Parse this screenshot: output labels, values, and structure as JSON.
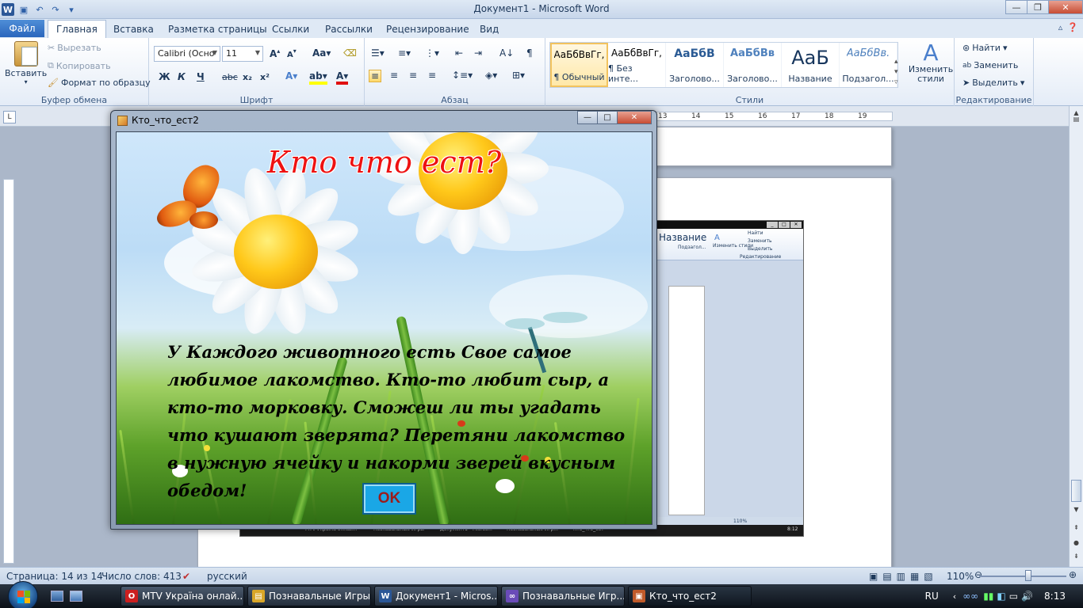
{
  "app": {
    "window_title": "Документ1  -  Microsoft Word",
    "logo": "W"
  },
  "tabs": {
    "file": "Файл",
    "items": [
      "Главная",
      "Вставка",
      "Разметка страницы",
      "Ссылки",
      "Рассылки",
      "Рецензирование",
      "Вид"
    ]
  },
  "ribbon": {
    "clipboard": {
      "label": "Буфер обмена",
      "paste": "Вставить",
      "cut": "Вырезать",
      "copy": "Копировать",
      "format_painter": "Формат по образцу"
    },
    "font": {
      "label": "Шрифт",
      "family": "Calibri (Осно",
      "size": "11",
      "bold": "Ж",
      "italic": "К",
      "underline": "Ч",
      "strike": "abc",
      "subscript": "x₂",
      "superscript": "x²",
      "grow": "A",
      "shrink": "A",
      "change_case": "Аа"
    },
    "paragraph": {
      "label": "Абзац"
    },
    "styles": {
      "label": "Стили",
      "items": [
        {
          "sample": "АаБбВвГг,",
          "name": "¶ Обычный",
          "kind": "normal"
        },
        {
          "sample": "АаБбВвГг,",
          "name": "¶ Без инте...",
          "kind": "normal"
        },
        {
          "sample": "АаБбВ",
          "name": "Заголово...",
          "kind": "h1"
        },
        {
          "sample": "АаБбВв",
          "name": "Заголово...",
          "kind": "h2"
        },
        {
          "sample": "АаБ",
          "name": "Название",
          "kind": "t"
        },
        {
          "sample": "АаБбВв.",
          "name": "Подзагол...",
          "kind": "st"
        }
      ],
      "change_styles": "Изменить стили"
    },
    "editing": {
      "label": "Редактирование",
      "find": "Найти",
      "replace": "Заменить",
      "select": "Выделить"
    }
  },
  "ruler": {
    "numbers": [
      "13",
      "14",
      "15",
      "16",
      "17",
      "18",
      "19"
    ]
  },
  "dialog": {
    "title": "Кто_что_ест2",
    "heading": "Кто что ест?",
    "body": "У Каждого животного есть Свое самое любимое лакомство. Кто-то любит сыр, а кто-то морковку. Сможеш ли ты угадать что кушают зверята? Перетяни лакомство в нужную ячейку и накорми зверей вкусным обедом!",
    "ok": "OK"
  },
  "embedded": {
    "find": "Найти",
    "replace": "Заменить",
    "select": "Выделить",
    "change_styles": "Изменить стили",
    "group": "Редактирование",
    "title_style": "Название",
    "subtitle_style": "Подзагол...",
    "zoom": "110%",
    "time": "8:12",
    "tasks": [
      "MTV Україна онлай...",
      "Познавальные Игры",
      "Документ1 - Micros...",
      "Познавальные Игр...",
      "Кто_что_ест"
    ]
  },
  "statusbar": {
    "page": "Страница: 14 из 14",
    "words": "Число слов: 413",
    "language": "русский",
    "zoom": "110%"
  },
  "taskbar": {
    "items": [
      {
        "label": "MTV Україна онлай...",
        "icon": "O",
        "color": "#cc1f1f"
      },
      {
        "label": "Познавальные Игры",
        "icon": "▤",
        "color": "#d9a628"
      },
      {
        "label": "Документ1 - Micros...",
        "icon": "W",
        "color": "#2b5797"
      },
      {
        "label": "Познавальные Игр...",
        "icon": "∞",
        "color": "#6a4bb8"
      },
      {
        "label": "Кто_что_ест2",
        "icon": "▣",
        "color": "#c05a2a"
      }
    ],
    "lang": "RU",
    "time": "8:13"
  }
}
